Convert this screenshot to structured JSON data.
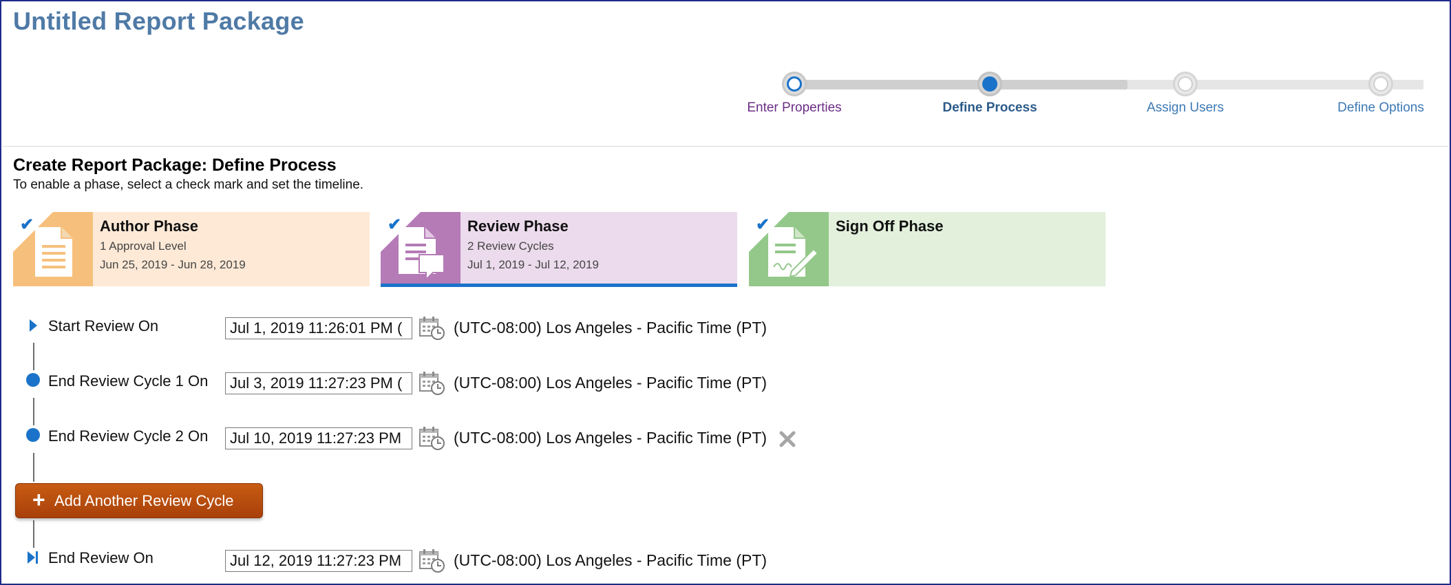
{
  "page": {
    "title": "Untitled Report Package"
  },
  "train": {
    "steps": [
      {
        "label": "Enter Properties",
        "state": "visited"
      },
      {
        "label": "Define Process",
        "state": "current"
      },
      {
        "label": "Assign Users",
        "state": "todo"
      },
      {
        "label": "Define Options",
        "state": "todo"
      }
    ]
  },
  "section": {
    "title": "Create Report Package: Define Process",
    "instructions": "To enable a phase, select a check mark and set the timeline."
  },
  "phases": [
    {
      "name": "Author Phase",
      "sub": "1 Approval Level",
      "dates": "Jun 25, 2019 - Jun 28, 2019",
      "enabled": true,
      "color": "#f6c07c"
    },
    {
      "name": "Review Phase",
      "sub": "2 Review Cycles",
      "dates": "Jul 1, 2019 - Jul 12, 2019",
      "enabled": true,
      "selected": true,
      "color": "#b57bb6"
    },
    {
      "name": "Sign Off Phase",
      "sub": "",
      "dates": "",
      "enabled": true,
      "color": "#94c88a"
    }
  ],
  "timeline": {
    "start": {
      "label": "Start Review On",
      "value": "Jul 1, 2019 11:26:01 PM (",
      "tz": "(UTC-08:00) Los Angeles - Pacific Time (PT)"
    },
    "cycle1": {
      "label": "End Review Cycle 1 On",
      "value": "Jul 3, 2019 11:27:23 PM (",
      "tz": "(UTC-08:00) Los Angeles - Pacific Time (PT)"
    },
    "cycle2": {
      "label": "End Review Cycle 2 On",
      "value": "Jul 10, 2019 11:27:23 PM",
      "tz": "(UTC-08:00) Los Angeles - Pacific Time (PT)"
    },
    "add_button": "Add Another Review Cycle",
    "end": {
      "label": "End Review On",
      "value": "Jul 12, 2019 11:27:23 PM",
      "tz": "(UTC-08:00) Los Angeles - Pacific Time (PT)"
    }
  },
  "colors": {
    "accent": "#1a73c9",
    "title": "#4f7aa6",
    "add_button": "#b9490d"
  },
  "icons": [
    "checkmark-icon",
    "document-icon",
    "review-document-icon",
    "sign-off-icon",
    "calendar-clock-icon",
    "remove-x-icon",
    "plus-icon"
  ]
}
